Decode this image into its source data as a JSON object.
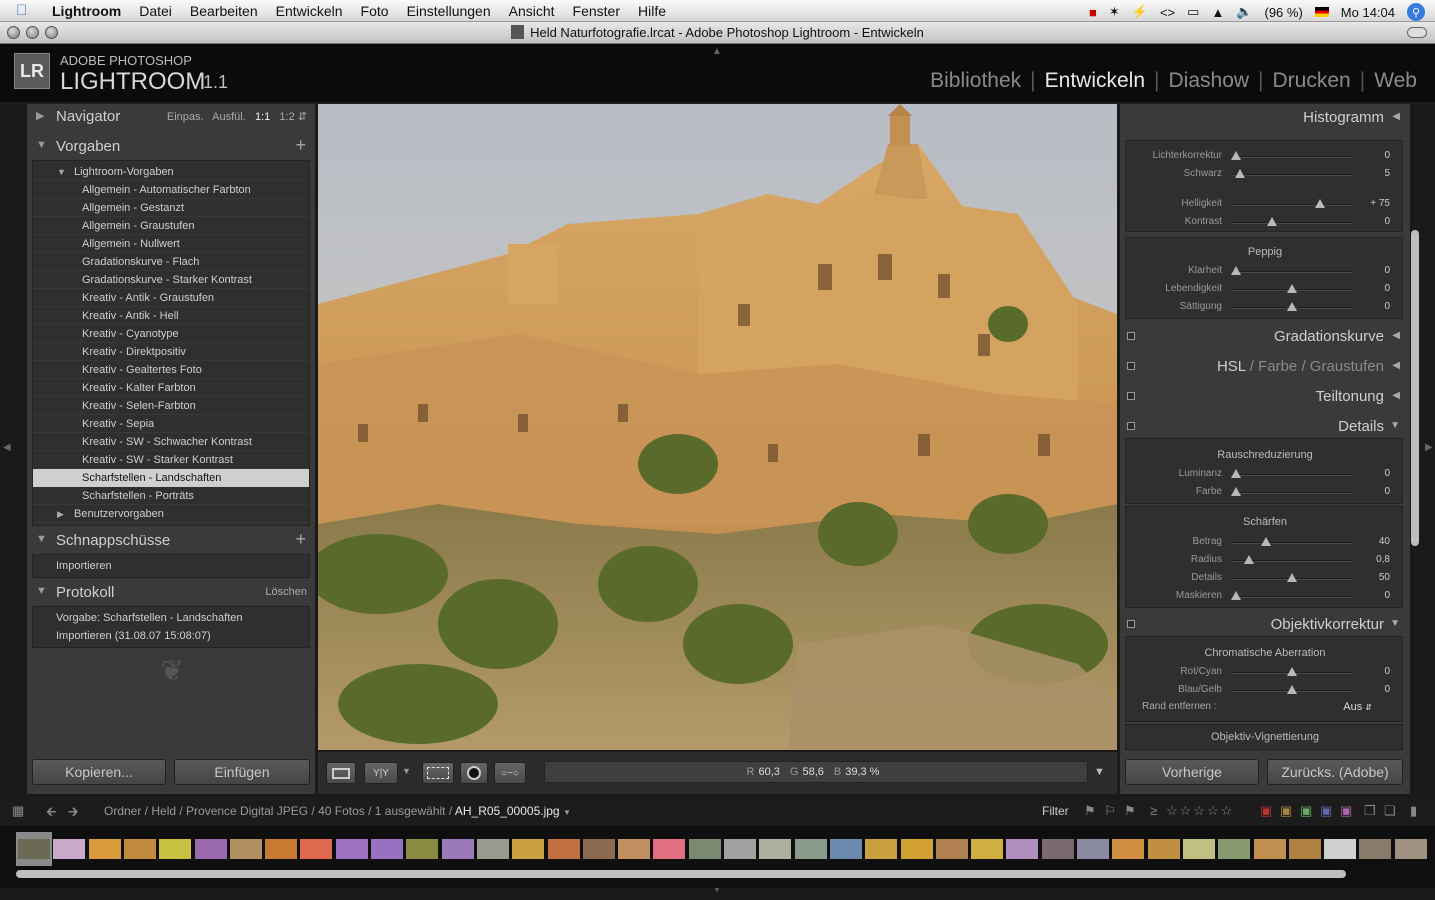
{
  "menubar": {
    "app": "Lightroom",
    "items": [
      "Datei",
      "Bearbeiten",
      "Entwickeln",
      "Foto",
      "Einstellungen",
      "Ansicht",
      "Fenster",
      "Hilfe"
    ],
    "battery": "(96 %)",
    "clock": "Mo 14:04"
  },
  "window": {
    "title": "Held Naturfotografie.lrcat - Adobe Photoshop Lightroom - Entwickeln"
  },
  "header": {
    "logo": "LR",
    "brand": "ADOBE PHOTOSHOP",
    "product": "LIGHTROOM",
    "version": "1.1",
    "modules": [
      "Bibliothek",
      "Entwickeln",
      "Diashow",
      "Drucken",
      "Web"
    ],
    "active_module": "Entwickeln"
  },
  "left": {
    "navigator": {
      "title": "Navigator",
      "zoom": [
        "Einpas.",
        "Ausfül.",
        "1:1",
        "1:2"
      ]
    },
    "presets": {
      "title": "Vorgaben",
      "folder": "Lightroom-Vorgaben",
      "items": [
        "Allgemein - Automatischer Farbton",
        "Allgemein - Gestanzt",
        "Allgemein - Graustufen",
        "Allgemein - Nullwert",
        "Gradationskurve - Flach",
        "Gradationskurve - Starker Kontrast",
        "Kreativ - Antik - Graustufen",
        "Kreativ - Antik - Hell",
        "Kreativ - Cyanotype",
        "Kreativ - Direktpositiv",
        "Kreativ - Gealtertes Foto",
        "Kreativ - Kalter Farbton",
        "Kreativ - Selen-Farbton",
        "Kreativ - Sepia",
        "Kreativ - SW - Schwacher Kontrast",
        "Kreativ - SW - Starker Kontrast",
        "Scharfstellen - Landschaften",
        "Scharfstellen - Porträts"
      ],
      "selected": "Scharfstellen - Landschaften",
      "user_folder": "Benutzervorgaben"
    },
    "snapshots": {
      "title": "Schnappschüsse",
      "items": [
        "Importieren"
      ]
    },
    "history": {
      "title": "Protokoll",
      "clear": "Löschen",
      "items": [
        "Vorgabe: Scharfstellen - Landschaften",
        "Importieren (31.08.07 15:08:07)"
      ]
    },
    "copy_button": "Kopieren...",
    "paste_button": "Einfügen"
  },
  "toolbar": {
    "readout": {
      "r_label": "R",
      "r": "60,3",
      "g_label": "G",
      "g": "58,6",
      "b_label": "B",
      "b": "39,3 %"
    }
  },
  "right": {
    "histogram_title": "Histogramm",
    "basic_sliders": [
      {
        "label": "Lichterkorrektur",
        "value": "0",
        "pos": 0.03
      },
      {
        "label": "Schwarz",
        "value": "5",
        "pos": 0.07
      },
      {
        "label": "Helligkeit",
        "value": "+ 75",
        "pos": 0.73
      },
      {
        "label": "Kontrast",
        "value": "0",
        "pos": 0.33
      }
    ],
    "presence": {
      "title": "Peppig",
      "sliders": [
        {
          "label": "Klarheit",
          "value": "0",
          "pos": 0.03
        },
        {
          "label": "Lebendigkeit",
          "value": "0",
          "pos": 0.5
        },
        {
          "label": "Sättigung",
          "value": "0",
          "pos": 0.5
        }
      ]
    },
    "tone_curve": "Gradationskurve",
    "hsl": {
      "a": "HSL",
      "sep": "/",
      "b": "Farbe",
      "c": "Graustufen"
    },
    "split_toning": "Teiltonung",
    "details": {
      "title": "Details",
      "noise_title": "Rauschreduzierung",
      "noise": [
        {
          "label": "Luminanz",
          "value": "0",
          "pos": 0.03
        },
        {
          "label": "Farbe",
          "value": "0",
          "pos": 0.03
        }
      ],
      "sharpen_title": "Schärfen",
      "sharpen": [
        {
          "label": "Betrag",
          "value": "40",
          "pos": 0.28
        },
        {
          "label": "Radius",
          "value": "0,8",
          "pos": 0.14
        },
        {
          "label": "Details",
          "value": "50",
          "pos": 0.5
        },
        {
          "label": "Maskieren",
          "value": "0",
          "pos": 0.03
        }
      ]
    },
    "lens": {
      "title": "Objektivkorrektur",
      "ca_title": "Chromatische Aberration",
      "ca": [
        {
          "label": "Rot/Cyan",
          "value": "0",
          "pos": 0.5
        },
        {
          "label": "Blau/Gelb",
          "value": "0",
          "pos": 0.5
        }
      ],
      "fringe_label": "Rand entfernen :",
      "fringe_value": "Aus",
      "vignette_title": "Objektiv-Vignettierung"
    },
    "prev_button": "Vorherige",
    "reset_button": "Zurücks. (Adobe)"
  },
  "filmbar": {
    "path": "Ordner / Held / Provence Digital JPEG / 40 Fotos / 1 ausgewählt / ",
    "file": "AH_R05_00005.jpg",
    "filter": "Filter"
  },
  "filmstrip": {
    "thumbs": [
      "#6a6a55",
      "#c9a9c9",
      "#d89a3a",
      "#c08a40",
      "#c8c040",
      "#9a6ab0",
      "#b09060",
      "#c87a30",
      "#e06a50",
      "#a070c0",
      "#9a70c0",
      "#8a8a40",
      "#9a7ab8",
      "#9a9a90",
      "#c8a040",
      "#c07040",
      "#8a6a50",
      "#c09060",
      "#e07080",
      "#7a8a70",
      "#a0a0a0",
      "#b0b0a0",
      "#8a9a8a",
      "#6a8ab0",
      "#c8a040",
      "#d0a030",
      "#b08050",
      "#d0b040",
      "#b090c0",
      "#7a6a70",
      "#8a8aa0",
      "#d09040",
      "#c09040",
      "#c0c080",
      "#8a9a70",
      "#c09050",
      "#b08040",
      "#d0d0d0",
      "#8a7a6a",
      "#a09080"
    ],
    "selected_index": 0
  }
}
